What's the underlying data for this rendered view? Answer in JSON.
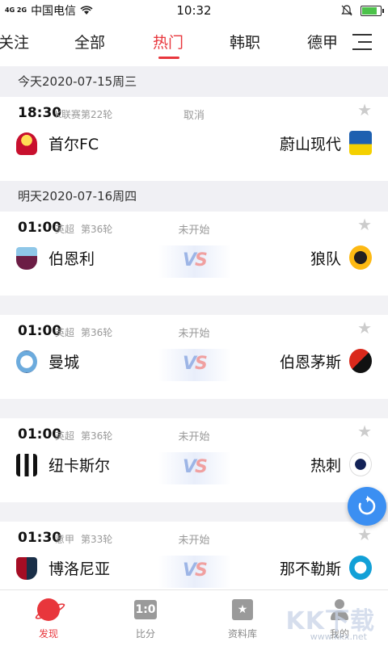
{
  "status_bar": {
    "signal": "4G 2G",
    "carrier": "中国电信",
    "time": "10:32"
  },
  "tabs": [
    {
      "label": "关注",
      "active": false
    },
    {
      "label": "全部",
      "active": false
    },
    {
      "label": "热门",
      "active": true
    },
    {
      "label": "韩职",
      "active": false
    },
    {
      "label": "德甲",
      "active": false
    }
  ],
  "sections": [
    {
      "date": "今天2020-07-15周三",
      "matches": [
        {
          "time": "18:30",
          "league": "K联赛",
          "round": "第22轮",
          "status": "取消",
          "home": "首尔FC",
          "away": "蔚山现代",
          "home_crest": "fc-seoul-crest",
          "away_crest": "ulsan-hyundai-crest",
          "show_vs": false
        }
      ]
    },
    {
      "date": "明天2020-07-16周四",
      "matches": [
        {
          "time": "01:00",
          "league": "英超",
          "round": "第36轮",
          "status": "未开始",
          "home": "伯恩利",
          "away": "狼队",
          "home_crest": "burnley-crest",
          "away_crest": "wolves-crest",
          "show_vs": true
        },
        {
          "time": "01:00",
          "league": "英超",
          "round": "第36轮",
          "status": "未开始",
          "home": "曼城",
          "away": "伯恩茅斯",
          "home_crest": "man-city-crest",
          "away_crest": "bournemouth-crest",
          "show_vs": true
        },
        {
          "time": "01:00",
          "league": "英超",
          "round": "第36轮",
          "status": "未开始",
          "home": "纽卡斯尔",
          "away": "热刺",
          "home_crest": "newcastle-crest",
          "away_crest": "tottenham-crest",
          "show_vs": true
        },
        {
          "time": "01:30",
          "league": "意甲",
          "round": "第33轮",
          "status": "未开始",
          "home": "博洛尼亚",
          "away": "那不勒斯",
          "home_crest": "bologna-crest",
          "away_crest": "napoli-crest",
          "show_vs": true
        }
      ]
    }
  ],
  "vs_label": {
    "v": "V",
    "s": "S"
  },
  "bottom_nav": [
    {
      "label": "发现",
      "icon": "discover-icon",
      "active": true
    },
    {
      "label": "比分",
      "icon": "score-icon",
      "icon_text": "1:0",
      "active": false
    },
    {
      "label": "资料库",
      "icon": "library-icon",
      "icon_text": "★",
      "active": false
    },
    {
      "label": "我的",
      "icon": "profile-icon",
      "active": false
    }
  ],
  "watermark": {
    "text": "KK下载",
    "url": "www.kkx.net"
  },
  "colors": {
    "accent": "#e8363c",
    "fab": "#3b8ff2",
    "background": "#f2f2f5"
  }
}
